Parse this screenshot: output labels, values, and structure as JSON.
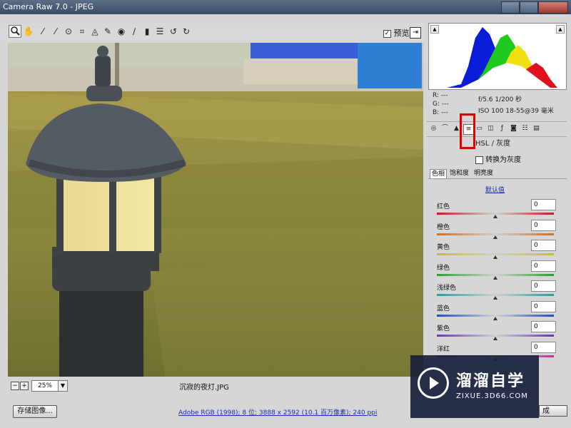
{
  "window": {
    "title": "Camera Raw 7.0 - JPEG"
  },
  "toolbar": {
    "tools": [
      "zoom-icon",
      "hand-icon",
      "white-balance-icon",
      "color-sampler-icon",
      "target-adjust-icon",
      "crop-icon",
      "straighten-icon",
      "spot-removal-icon",
      "red-eye-icon",
      "adjustment-brush-icon",
      "graduated-filter-icon",
      "preferences-icon",
      "rotate-left-icon",
      "rotate-right-icon"
    ],
    "preview_label": "预览",
    "preview_checked": "✓"
  },
  "readout": {
    "r": "R: ---",
    "g": "G: ---",
    "b": "B: ---",
    "exposure": "f/5.6  1/200 秒",
    "iso_lens": "ISO 100  18-55@39 毫米"
  },
  "panel": {
    "title": "HSL / 灰度",
    "convert_gray": "转换为灰度",
    "subtabs": [
      "色相",
      "饱和度",
      "明亮度"
    ],
    "default_label": "默认值",
    "sliders": [
      {
        "label": "红色",
        "value": "0",
        "color": "#c02020"
      },
      {
        "label": "橙色",
        "value": "0",
        "color": "#d07020"
      },
      {
        "label": "黄色",
        "value": "0",
        "color": "#c8c020"
      },
      {
        "label": "绿色",
        "value": "0",
        "color": "#30a030"
      },
      {
        "label": "浅绿色",
        "value": "0",
        "color": "#20a0a0"
      },
      {
        "label": "蓝色",
        "value": "0",
        "color": "#2050c0"
      },
      {
        "label": "紫色",
        "value": "0",
        "color": "#7030c0"
      },
      {
        "label": "洋红",
        "value": "0",
        "color": "#c030a0"
      }
    ]
  },
  "status": {
    "zoom_minus": "−",
    "zoom_plus": "+",
    "zoom": "25%",
    "filename": "沉寂的夜灯.JPG"
  },
  "bottom": {
    "save_label": "存储图像...",
    "workflow": "Adobe RGB (1998); 8 位; 3888 x 2592 (10.1 百万像素); 240 ppi",
    "done_label": "成"
  },
  "watermark": {
    "cn": "溜溜自学",
    "en": "ZIXUE.3D66.COM"
  }
}
